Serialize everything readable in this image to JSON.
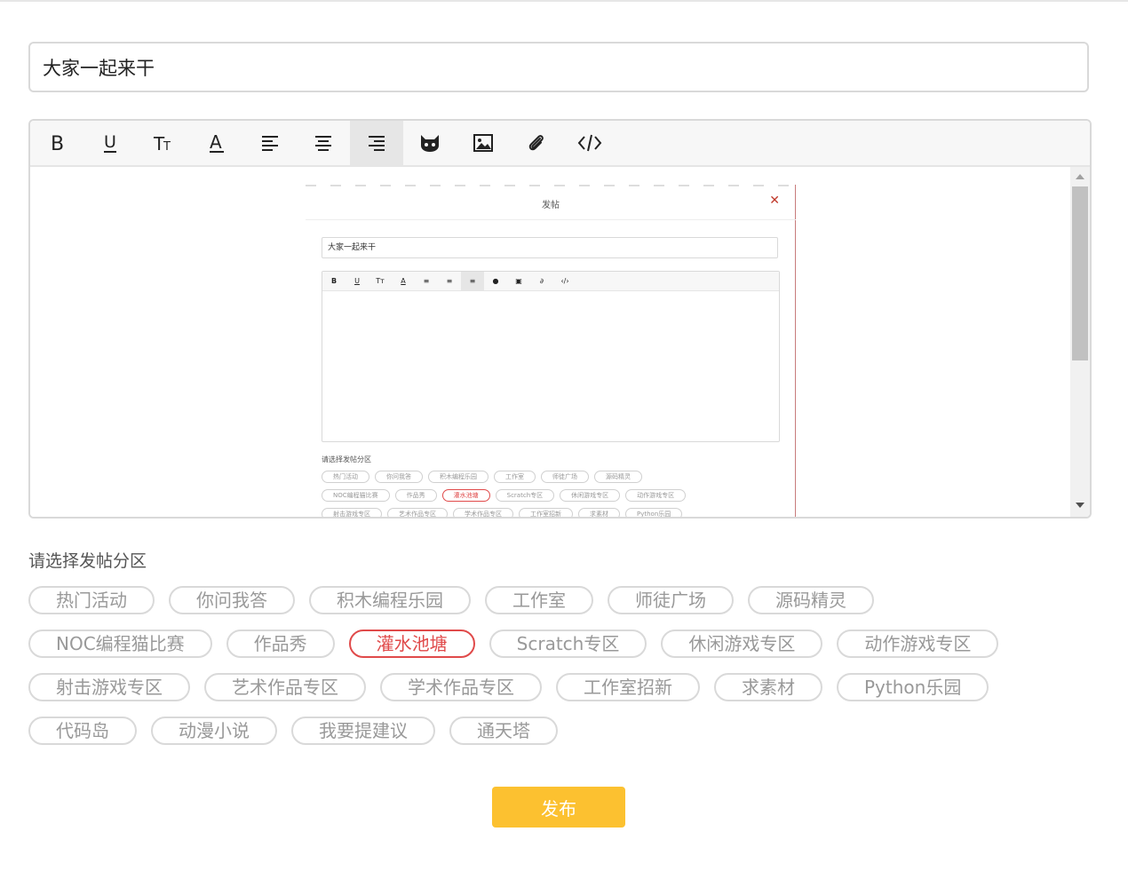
{
  "post": {
    "title_value": "大家一起来干"
  },
  "editor": {
    "toolbar": [
      {
        "name": "bold-icon",
        "glyph": "B",
        "active": false
      },
      {
        "name": "underline-icon",
        "glyph": "U",
        "active": false
      },
      {
        "name": "font-size-icon",
        "glyph": "Tт",
        "active": false
      },
      {
        "name": "font-color-icon",
        "glyph": "A",
        "active": false
      },
      {
        "name": "align-left-icon",
        "glyph": "",
        "active": false
      },
      {
        "name": "align-center-icon",
        "glyph": "",
        "active": false
      },
      {
        "name": "align-right-icon",
        "glyph": "",
        "active": true
      },
      {
        "name": "emoji-cat-icon",
        "glyph": "",
        "active": false
      },
      {
        "name": "image-icon",
        "glyph": "",
        "active": false
      },
      {
        "name": "attachment-icon",
        "glyph": "",
        "active": false
      },
      {
        "name": "code-icon",
        "glyph": "</>",
        "active": false
      }
    ],
    "embedded_screenshot": {
      "dialog_title": "发帖",
      "title_value": "大家一起来干",
      "section_label": "请选择发帖分区",
      "tag_rows": [
        [
          "热门活动",
          "你问我答",
          "积木编程乐园",
          "工作室",
          "师徒广场",
          "源码精灵"
        ],
        [
          "NOC编程猫比赛",
          "作品秀",
          "灌水池塘",
          "Scratch专区",
          "休闲游戏专区",
          "动作游戏专区"
        ],
        [
          "射击游戏专区",
          "艺术作品专区",
          "学术作品专区",
          "工作室招新",
          "求素材",
          "Python乐园"
        ]
      ],
      "selected_tag": "灌水池塘"
    }
  },
  "section": {
    "label": "请选择发帖分区"
  },
  "tags": {
    "rows": [
      [
        "热门活动",
        "你问我答",
        "积木编程乐园",
        "工作室",
        "师徒广场",
        "源码精灵"
      ],
      [
        "NOC编程猫比赛",
        "作品秀",
        "灌水池塘",
        "Scratch专区",
        "休闲游戏专区",
        "动作游戏专区"
      ],
      [
        "射击游戏专区",
        "艺术作品专区",
        "学术作品专区",
        "工作室招新",
        "求素材",
        "Python乐园"
      ],
      [
        "代码岛",
        "动漫小说",
        "我要提建议",
        "通天塔"
      ]
    ],
    "selected": "灌水池塘"
  },
  "actions": {
    "publish_label": "发布"
  },
  "colors": {
    "accent_selected": "#e04a4a",
    "publish_button": "#fcc130",
    "border": "#d9d9d9"
  }
}
